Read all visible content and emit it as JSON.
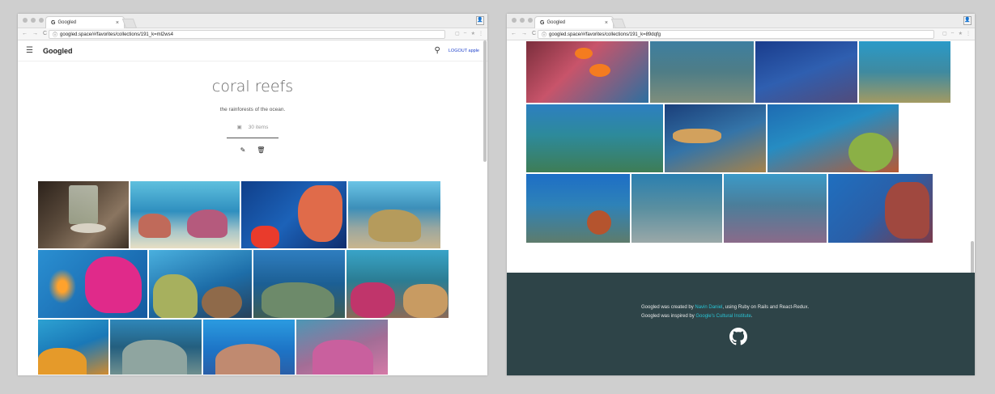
{
  "left_window": {
    "tab_title": "Googled",
    "tab_close": "×",
    "url": "googled.space/#/favorites/collections/191_k=ml2ws4",
    "brand": "Googled",
    "logout": "LOGOUT apple",
    "collection_title": "coral reefs",
    "collection_subtitle": "the rainforests of the ocean.",
    "item_count": "30 items",
    "icons": {
      "edit": "pencil-icon",
      "delete": "trash-icon",
      "menu": "hamburger-icon",
      "search": "search-icon",
      "count": "image-icon"
    }
  },
  "right_window": {
    "tab_title": "Googled",
    "tab_close": "×",
    "url": "googled.space/#/favorites/collections/191_k=89dqfg",
    "footer": {
      "l1_prefix": "Googled was created by ",
      "l1_link": "Navin Daniel",
      "l1_suffix": ", using Ruby on Rails and React-Redux.",
      "l2_prefix": "Googled was inspired by ",
      "l2_link": "Google's Cultural Institute",
      "l2_suffix": ".",
      "icon": "github-icon"
    }
  },
  "colors": {
    "footer_bg": "#2e4448",
    "link": "#29c3d4",
    "logout_link": "#2244cc"
  }
}
